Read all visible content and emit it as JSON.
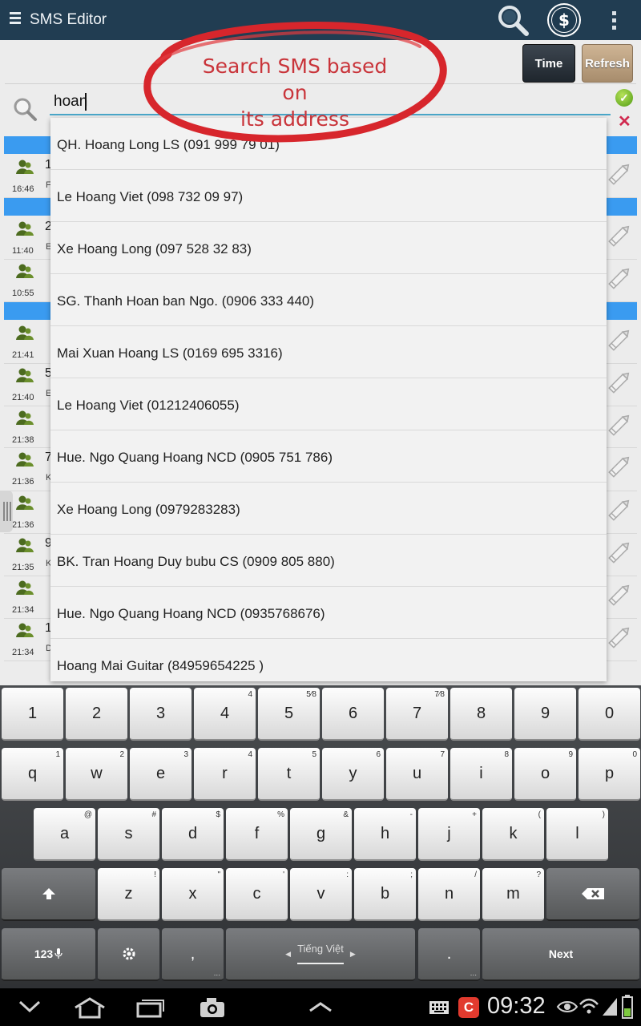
{
  "app": {
    "title": "SMS Editor"
  },
  "toolbar": {
    "time_label": "Time",
    "refresh_label": "Refresh"
  },
  "search": {
    "value": "hoan"
  },
  "annotation": {
    "line1": "Search SMS based on",
    "line2": "its address"
  },
  "rows": [
    {
      "digit": "1",
      "time": "16:46",
      "letter": "F"
    },
    {
      "digit": "2",
      "time": "11:40",
      "letter": "E"
    },
    {
      "digit": "",
      "time": "10:55",
      "letter": ""
    },
    {
      "digit": "",
      "time": "21:41",
      "letter": ""
    },
    {
      "digit": "5",
      "time": "21:40",
      "letter": "E"
    },
    {
      "digit": "",
      "time": "21:38",
      "letter": ""
    },
    {
      "digit": "7",
      "time": "21:36",
      "letter": "K"
    },
    {
      "digit": "",
      "time": "21:36",
      "letter": ""
    },
    {
      "digit": "9",
      "time": "21:35",
      "letter": "K"
    },
    {
      "digit": "",
      "time": "21:34",
      "letter": ""
    },
    {
      "digit": "1",
      "time": "21:34",
      "letter": "D"
    }
  ],
  "suggestions": [
    "QH. Hoang Long LS (091 999 79 01)",
    "Le Hoang Viet (098 732 09 97)",
    "Xe Hoang Long (097 528 32 83)",
    "SG. Thanh Hoan ban Ngo. (0906 333 440)",
    "Mai Xuan Hoang LS (0169 695 3316)",
    "Le Hoang Viet (01212406055)",
    "Hue. Ngo Quang Hoang NCD (0905 751 786)",
    "Xe Hoang Long (0979283283)",
    "BK. Tran Hoang Duy bubu CS (0909 805 880)",
    "Hue. Ngo Quang Hoang NCD (0935768676)",
    "Hoang Mai Guitar (84959654225 )"
  ],
  "keyboard": {
    "row_numbers": [
      {
        "k": "1",
        "s": ""
      },
      {
        "k": "2",
        "s": ""
      },
      {
        "k": "3",
        "s": ""
      },
      {
        "k": "4",
        "s": "4"
      },
      {
        "k": "5",
        "s": "5⁄8"
      },
      {
        "k": "6",
        "s": ""
      },
      {
        "k": "7",
        "s": "7⁄8"
      },
      {
        "k": "8",
        "s": ""
      },
      {
        "k": "9",
        "s": ""
      },
      {
        "k": "0",
        "s": ""
      }
    ],
    "row_q": [
      {
        "k": "q",
        "s": "1"
      },
      {
        "k": "w",
        "s": "2"
      },
      {
        "k": "e",
        "s": "3"
      },
      {
        "k": "r",
        "s": "4"
      },
      {
        "k": "t",
        "s": "5"
      },
      {
        "k": "y",
        "s": "6"
      },
      {
        "k": "u",
        "s": "7"
      },
      {
        "k": "i",
        "s": "8"
      },
      {
        "k": "o",
        "s": "9"
      },
      {
        "k": "p",
        "s": "0"
      }
    ],
    "row_a": [
      {
        "k": "a",
        "s": "@"
      },
      {
        "k": "s",
        "s": "#"
      },
      {
        "k": "d",
        "s": "$"
      },
      {
        "k": "f",
        "s": "%"
      },
      {
        "k": "g",
        "s": "&"
      },
      {
        "k": "h",
        "s": "-"
      },
      {
        "k": "j",
        "s": "+"
      },
      {
        "k": "k",
        "s": "("
      },
      {
        "k": "l",
        "s": ")"
      }
    ],
    "row_z": [
      {
        "k": "z",
        "s": "!"
      },
      {
        "k": "x",
        "s": "\""
      },
      {
        "k": "c",
        "s": "'"
      },
      {
        "k": "v",
        "s": ":"
      },
      {
        "k": "b",
        "s": ";"
      },
      {
        "k": "n",
        "s": "/"
      },
      {
        "k": "m",
        "s": "?"
      }
    ],
    "sym_label": "123",
    "comma": ",",
    "space_label": "Tiếng Việt",
    "period": ".",
    "next_label": "Next"
  },
  "status": {
    "clock": "09:32"
  }
}
